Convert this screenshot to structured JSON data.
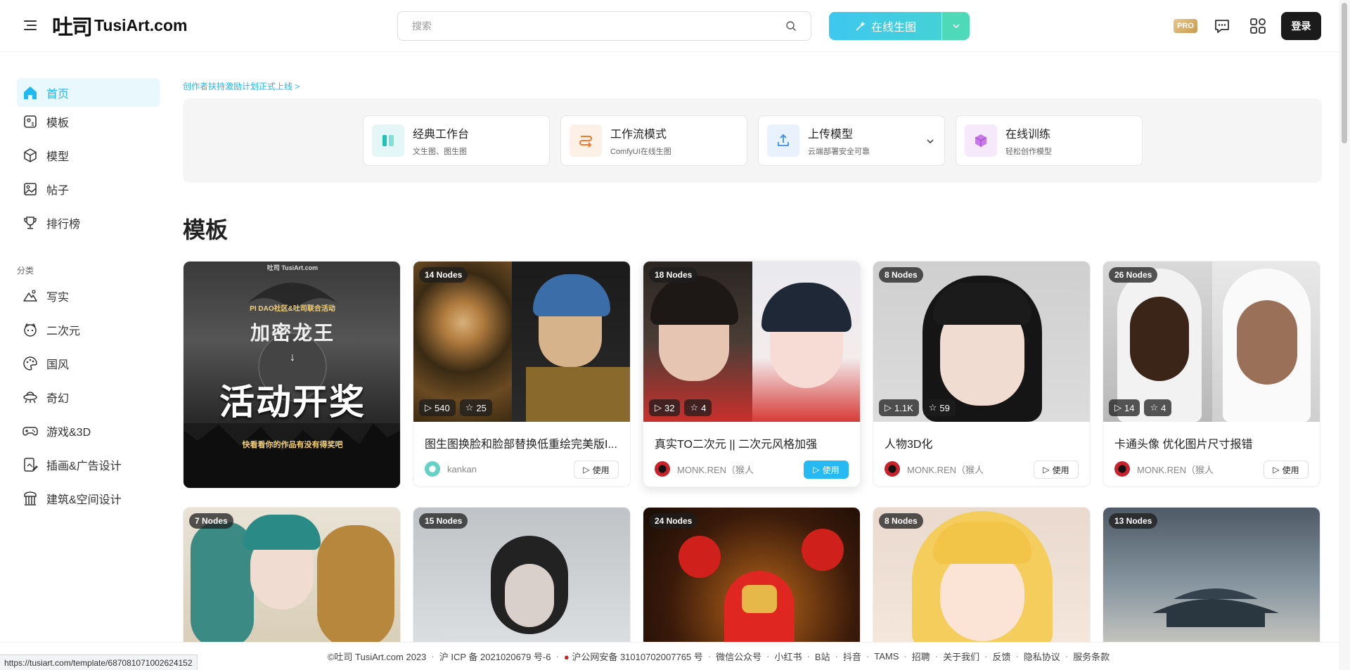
{
  "header": {
    "logo_mark": "吐司",
    "logo_text": "TusiArt.com",
    "search_placeholder": "搜索",
    "create_label": "在线生图",
    "pro_badge": "PRO",
    "login_label": "登录"
  },
  "sidebar": {
    "items": [
      {
        "label": "首页",
        "icon": "home-icon",
        "active": true
      },
      {
        "label": "模板",
        "icon": "template-icon"
      },
      {
        "label": "模型",
        "icon": "model-cube-icon"
      },
      {
        "label": "帖子",
        "icon": "image-post-icon"
      },
      {
        "label": "排行榜",
        "icon": "trophy-icon"
      }
    ],
    "category_label": "分类",
    "categories": [
      {
        "label": "写实",
        "icon": "landscape-icon"
      },
      {
        "label": "二次元",
        "icon": "anime-face-icon"
      },
      {
        "label": "国风",
        "icon": "palette-icon"
      },
      {
        "label": "奇幻",
        "icon": "ufo-icon"
      },
      {
        "label": "游戏&3D",
        "icon": "gamepad-icon"
      },
      {
        "label": "插画&广告设计",
        "icon": "illustration-icon"
      },
      {
        "label": "建筑&空间设计",
        "icon": "building-icon"
      }
    ]
  },
  "main": {
    "banner_link": "创作者扶持激励计划正式上线 >",
    "quick_actions": [
      {
        "title": "经典工作台",
        "subtitle": "文生图、图生图",
        "icon": "workbench-icon",
        "color": "#1fc3b4"
      },
      {
        "title": "工作流模式",
        "subtitle": "ComfyUI在线生图",
        "icon": "workflow-icon",
        "color": "#f07a2e"
      },
      {
        "title": "上传模型",
        "subtitle": "云端部署安全可靠",
        "icon": "upload-icon",
        "color": "#3b8ee8"
      },
      {
        "title": "在线训练",
        "subtitle": "轻松创作模型",
        "icon": "training-cube-icon",
        "color": "#b55be0"
      }
    ],
    "section_title": "模板",
    "cards": [
      {
        "nodes": "",
        "title": "",
        "author": "",
        "views": "",
        "stars": "",
        "poster": {
          "line1": "PI DAO社区&吐司联合活动",
          "line2": "加密龙王",
          "line3": "活动开奖",
          "line4": "快看看你的作品有没有得奖吧",
          "brand": "吐司 TusiArt.com"
        }
      },
      {
        "nodes": "14 Nodes",
        "views": "540",
        "stars": "25",
        "title": "图生图换脸和脸部替换低重绘完美版I...",
        "author": "kankan",
        "use": "使用"
      },
      {
        "nodes": "18 Nodes",
        "views": "32",
        "stars": "4",
        "title": "真实TO二次元 || 二次元风格加强",
        "author": "MONK.REN（猴人",
        "use": "使用"
      },
      {
        "nodes": "8 Nodes",
        "views": "1.1K",
        "stars": "59",
        "title": "人物3D化",
        "author": "MONK.REN（猴人",
        "use": "使用"
      },
      {
        "nodes": "26 Nodes",
        "views": "14",
        "stars": "4",
        "title": "卡通头像 优化图片尺寸报错",
        "author": "MONK.REN（猴人",
        "use": "使用"
      }
    ],
    "cards_row2": [
      {
        "nodes": "7 Nodes"
      },
      {
        "nodes": "15 Nodes"
      },
      {
        "nodes": "24 Nodes"
      },
      {
        "nodes": "8 Nodes"
      },
      {
        "nodes": "13 Nodes"
      }
    ]
  },
  "footer": {
    "items": [
      "©吐司 TusiArt.com 2023",
      "沪 ICP 备 2021020679 号-6",
      "沪公网安备 31010702007765 号",
      "微信公众号",
      "小红书",
      "B站",
      "抖音",
      "TAMS",
      "招聘",
      "关于我们",
      "反馈",
      "隐私协议",
      "服务条款"
    ]
  },
  "status_url": "https://tusiart.com/template/687081071002624152",
  "colors": {
    "accent": "#1fb8f0",
    "create_gradient_start": "#3ec7f0",
    "create_gradient_end": "#4ed9b9"
  }
}
